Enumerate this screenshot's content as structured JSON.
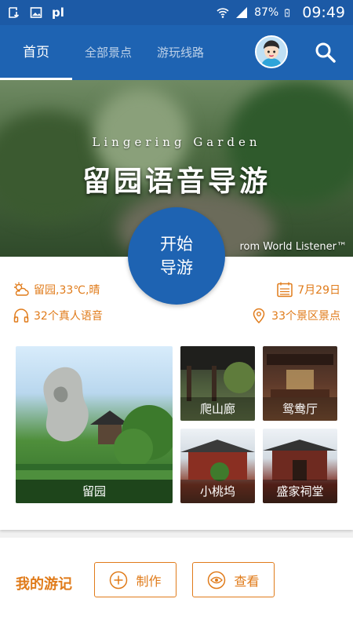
{
  "status_bar": {
    "battery": "87%",
    "time": "09:49",
    "carrier_icon": "pl"
  },
  "nav": {
    "tabs": [
      {
        "label": "首页",
        "active": true
      },
      {
        "label": "全部景点",
        "active": false
      },
      {
        "label": "游玩线路",
        "active": false
      }
    ]
  },
  "banner": {
    "title_en": "Lingering Garden",
    "title_cn": "留园语音导游",
    "credit": "rom World Listener™"
  },
  "start_button": {
    "line1": "开始",
    "line2": "导游"
  },
  "info": {
    "weather": "留园,33℃,晴",
    "voices": "32个真人语音",
    "date": "7月29日",
    "spots": "33个景区景点"
  },
  "tiles": [
    {
      "label": "留园"
    },
    {
      "label": "爬山廊"
    },
    {
      "label": "鸳鸯厅"
    },
    {
      "label": "小桃坞"
    },
    {
      "label": "盛家祠堂"
    }
  ],
  "diary": {
    "title": "我的游记",
    "make_label": "制作",
    "view_label": "查看"
  },
  "colors": {
    "primary": "#1e63b2",
    "accent": "#e07b1a"
  }
}
